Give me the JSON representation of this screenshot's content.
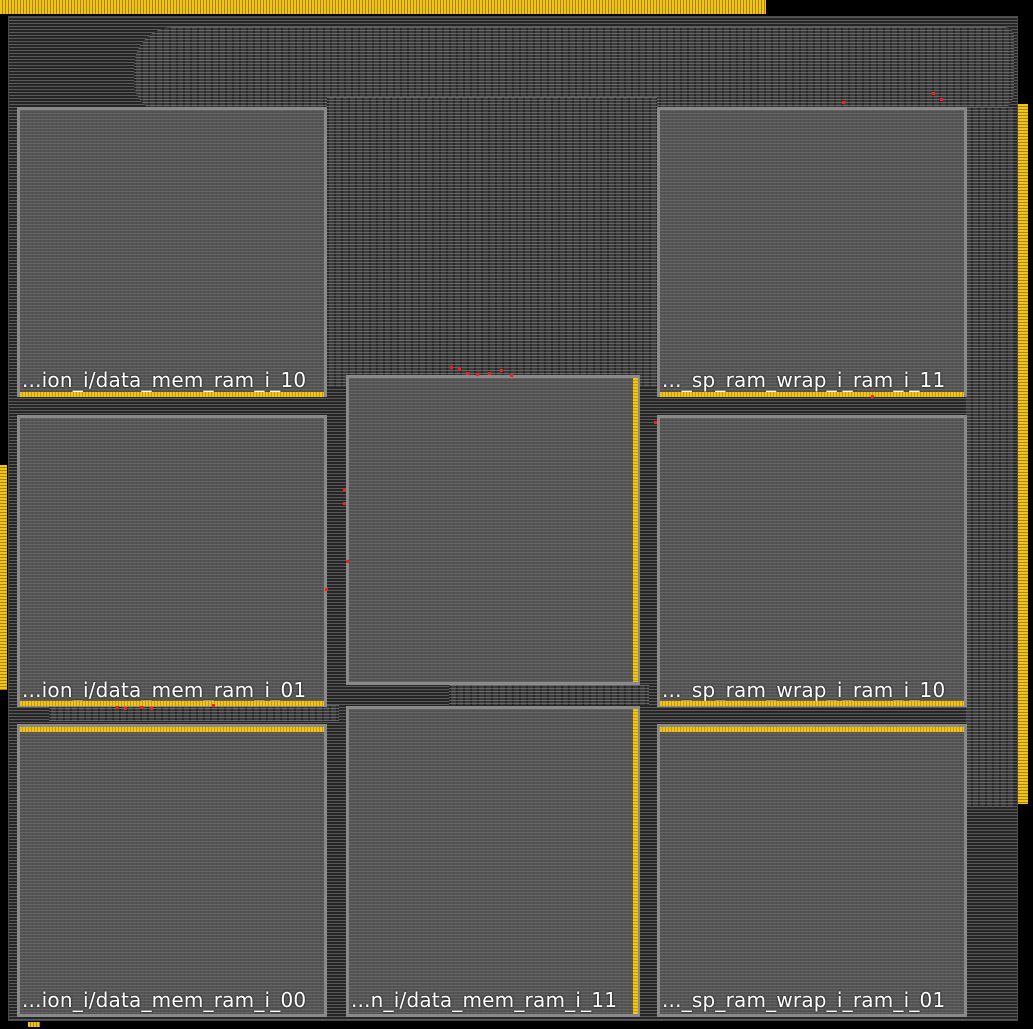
{
  "view": {
    "background": "#000000",
    "pin_color": "#f2c417",
    "macro_border_color": "#8a8a8a",
    "violation_color": "#ff1a1a"
  },
  "macros": [
    {
      "id": "m10",
      "label": "...ion_i/data_mem_ram_i_10"
    },
    {
      "id": "s11",
      "label": "..._sp_ram_wrap_i_ram_i_11"
    },
    {
      "id": "m01",
      "label": "...ion_i/data_mem_ram_i_01"
    },
    {
      "id": "center",
      "label": ""
    },
    {
      "id": "s10",
      "label": "..._sp_ram_wrap_i_ram_i_10"
    },
    {
      "id": "m00",
      "label": "...ion_i/data_mem_ram_i_00"
    },
    {
      "id": "m11",
      "label": "...n_i/data_mem_ram_i_11"
    },
    {
      "id": "s01",
      "label": "..._sp_ram_wrap_i_ram_i_01"
    }
  ]
}
